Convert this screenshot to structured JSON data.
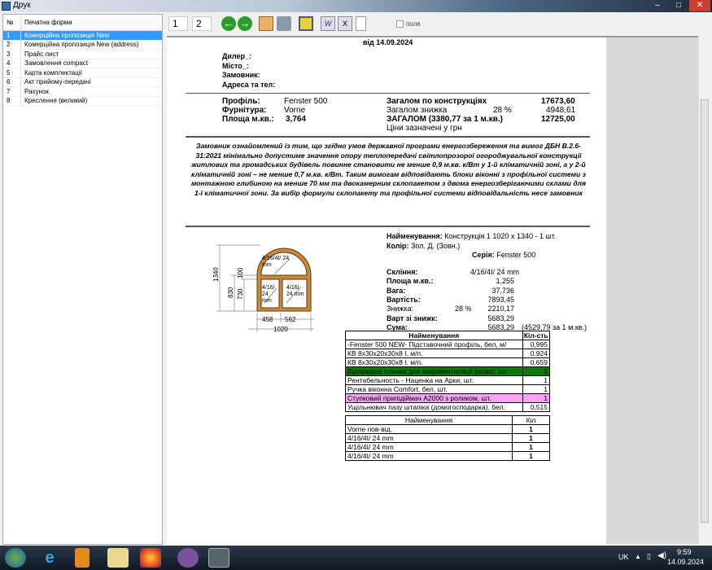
{
  "window": {
    "title": "Друк",
    "controls": [
      "–",
      "□",
      "✕"
    ]
  },
  "left_panel": {
    "col_num": "№",
    "col_form": "Печатна форма",
    "items": [
      {
        "n": "1",
        "label": "Комерційна пропозиція New",
        "selected": true
      },
      {
        "n": "2",
        "label": "Комерційна пропозиція New (address)"
      },
      {
        "n": "3",
        "label": "Прайс лист"
      },
      {
        "n": "4",
        "label": "Замовлення compact"
      },
      {
        "n": "5",
        "label": "Карта комплектації"
      },
      {
        "n": "6",
        "label": "Акт прийому-передачі"
      },
      {
        "n": "7",
        "label": "Рахунок"
      },
      {
        "n": "8",
        "label": "Креслення (великий)"
      }
    ]
  },
  "toolbar": {
    "page_from": "1",
    "page_to": "2",
    "fields_label": "поля",
    "fields_checked": false,
    "icons": [
      "back-arrow-icon",
      "forward-arrow-icon",
      "edit-icon",
      "print-icon",
      "image-icon",
      "word-icon",
      "excel-icon",
      "document-icon"
    ]
  },
  "doc": {
    "date": "від 14.09.2024",
    "dealer": "Дилер_:",
    "city": "Місто_:",
    "customer": "Замовник:",
    "address": "Адреса та тел:",
    "profile_label": "Профіль:",
    "profile": "Fenster 500",
    "fittings_label": "Фурнітура:",
    "fittings": "Vorne",
    "area_label": "Площа м.кв.:",
    "area": "3,764",
    "total_constr_label": "Загалом по конструкціях",
    "total_constr": "17673,60",
    "discount_label": "Загалом знижка",
    "discount_pct": "28 %",
    "discount": "4948,61",
    "total_label": "ЗАГАЛОМ   (3380,77 за 1 м.кв.)",
    "total": "12725,00",
    "currency_note": "Ціни зазначені у       грн",
    "notice": "Замовник ознайомлений із тим, що згідно умов державної програми енергозбереження та вимог ДБН В.2.6-31:2021 мінімально допустиме значення опору теплопередачі світлопрозорої огороджувальної конструкції житлових та громадських будівель повинне становити не менше 0,9 м.кв. к/Вт у 1-й кліматичній зоні, а у 2-й кліматичній зоні – не менше 0,7 м.кв. к/Вт. Таким вимогам відповідають блоки віконні з профільної системи з монтажною глибиною на менше 70 мм та двокамерним склопакетом з двома енергозберігаючими склами для 1-ї кліматичної зони. За вибір формули склопакету та профільної системи відповідальність несе замовник",
    "name_label": "Найменування:",
    "name": "Конструкція 1 1020 x 1340 - 1 шт.",
    "color_label": "Колір:",
    "color": "Зол. Д. (Зовн.)",
    "series_label": "Серія:",
    "series": "Fenster 500",
    "glass_label": "Скління:",
    "glass": "4/16/4І/    24 mm",
    "sq_label": "Площа м.кв.:",
    "sq": "1,255",
    "weight_label": "Вага:",
    "weight": "37,736",
    "cost_label": "Вартість:",
    "cost": "7893,45",
    "disc_label": "Знижка:",
    "disc_pct": "28 %",
    "disc": "2210,17",
    "after_disc_label": "Варт зі знижк:",
    "after_disc": "5683,29",
    "sum_label": "Сума:",
    "sum": "5683,29",
    "sum_per_m": "(4529,79 за 1 м.кв.)",
    "drawing": {
      "h_total": "1340",
      "h1": "830",
      "h2": "730",
      "h3": "100",
      "w1": "458",
      "w2": "562",
      "w_total": "1020",
      "glass_top": "4/16/4І/ 24 mm",
      "glass_left": "4/16/ 24 mm",
      "glass_right": "4/16/ 24 mm"
    },
    "table1": {
      "h_name": "Найменування",
      "h_qty": "Кіл-сть",
      "rows": [
        {
          "name": "-Fenster 500 NEW- Підставочний профіль, бел, м/",
          "qty": "0,995"
        },
        {
          "name": "КВ 8x30x20x30x8 I. м/п.",
          "qty": "0.924"
        },
        {
          "name": "КВ 8x30x20x30x8 I. м/п.",
          "qty": "0.659"
        },
        {
          "name": "Відповідна планка для мікровентиляції (нова), шт",
          "qty": "1",
          "bg": "#0b7a0b"
        },
        {
          "name": "Рентабельность - Наценка на Арки, шт.",
          "qty": "1"
        },
        {
          "name": "Ручка віконна Comfort, бел, шт.",
          "qty": "1"
        },
        {
          "name": "Ступковий припідіймач A2000 з роликом, шт.",
          "qty": "1",
          "bg": "#f4a3f4"
        },
        {
          "name": "Ущільнювач пазу штапіка (домогосподарка), бел.",
          "qty": "0,515"
        }
      ]
    },
    "table2": {
      "h_name": "Найменування",
      "h_qty": "Кіл",
      "rows": [
        {
          "name": "Vorne пов-від.",
          "qty": "1"
        },
        {
          "name": "4/16/4І/    24 mm",
          "qty": "1"
        },
        {
          "name": "4/16/4І/    24 mm",
          "qty": "1"
        },
        {
          "name": "4/16/4І/    24 mm",
          "qty": "1"
        }
      ]
    }
  },
  "taskbar": {
    "lang": "UK",
    "time": "9:59",
    "date": "14.09.2024",
    "apps": [
      "start-icon",
      "ie-icon",
      "media-player-icon",
      "explorer-icon",
      "firefox-icon",
      "viber-icon",
      "app-window-icon"
    ]
  }
}
